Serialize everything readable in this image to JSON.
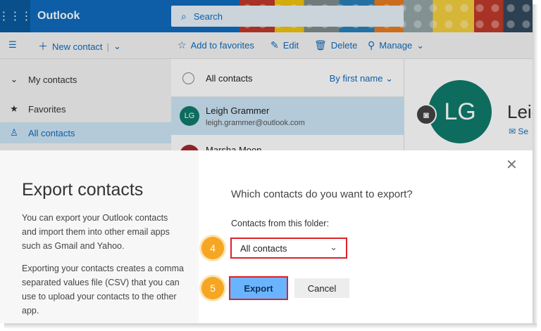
{
  "app": {
    "brand": "Outlook"
  },
  "search": {
    "placeholder": "Search"
  },
  "toolbar": {
    "new_contact": "New contact",
    "add_favorites": "Add to favorites",
    "edit": "Edit",
    "delete": "Delete",
    "manage": "Manage"
  },
  "sidebar": {
    "section": "My contacts",
    "items": [
      {
        "label": "Favorites"
      },
      {
        "label": "All contacts"
      }
    ]
  },
  "list": {
    "title": "All contacts",
    "sort": "By first name",
    "rows": [
      {
        "initials": "LG",
        "name": "Leigh Grammer",
        "email": "leigh.grammer@outlook.com"
      },
      {
        "name": "Marsha Moon"
      }
    ]
  },
  "detail": {
    "initials": "LG",
    "name": "Leigh",
    "email": "Se"
  },
  "dialog": {
    "title": "Export contacts",
    "para1": "You can export your Outlook contacts and import them into other email apps such as Gmail and Yahoo.",
    "para2": "Exporting your contacts creates a comma separated values file (CSV) that you can use to upload your contacts to the other app.",
    "question": "Which contacts do you want to export?",
    "folder_label": "Contacts from this folder:",
    "folder_value": "All contacts",
    "export_label": "Export",
    "cancel_label": "Cancel",
    "step4": "4",
    "step5": "5"
  },
  "colors": {
    "accent": "#0f6cbd",
    "highlight": "#e0202a",
    "step": "#f5a623"
  }
}
